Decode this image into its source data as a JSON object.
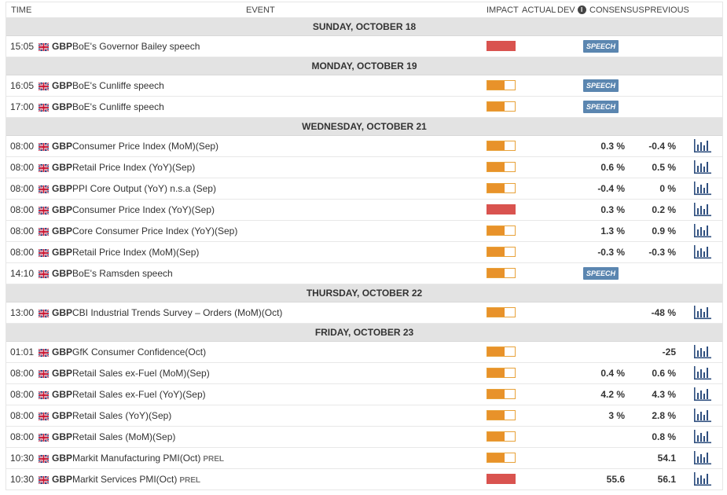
{
  "header": {
    "time": "TIME",
    "event": "EVENT",
    "impact": "IMPACT",
    "actual": "ACTUAL",
    "dev": "DEV",
    "consensus": "CONSENSUS",
    "previous": "PREVIOUS"
  },
  "colors": {
    "high_impact": "#d9534f",
    "medium_impact": "#e8922a",
    "speech_badge": "#5b86b0",
    "day_header_bg": "#e3e3e3",
    "chart_icon": "#2f4f7f"
  },
  "days": [
    {
      "label": "SUNDAY, OCTOBER 18",
      "events": [
        {
          "time": "15:05",
          "currency": "GBP",
          "name": "BoE's Governor Bailey speech",
          "tag": "",
          "impact": "high",
          "actual": "",
          "consensus": "",
          "previous": "",
          "speech": "SPEECH",
          "chart": false
        }
      ]
    },
    {
      "label": "MONDAY, OCTOBER 19",
      "events": [
        {
          "time": "16:05",
          "currency": "GBP",
          "name": "BoE's Cunliffe speech",
          "tag": "",
          "impact": "medium",
          "actual": "",
          "consensus": "",
          "previous": "",
          "speech": "SPEECH",
          "chart": false
        },
        {
          "time": "17:00",
          "currency": "GBP",
          "name": "BoE's Cunliffe speech",
          "tag": "",
          "impact": "medium",
          "actual": "",
          "consensus": "",
          "previous": "",
          "speech": "SPEECH",
          "chart": false
        }
      ]
    },
    {
      "label": "WEDNESDAY, OCTOBER 21",
      "events": [
        {
          "time": "08:00",
          "currency": "GBP",
          "name": "Consumer Price Index (MoM)(Sep)",
          "tag": "",
          "impact": "medium",
          "actual": "",
          "consensus": "0.3 %",
          "previous": "-0.4 %",
          "speech": "",
          "chart": true
        },
        {
          "time": "08:00",
          "currency": "GBP",
          "name": "Retail Price Index (YoY)(Sep)",
          "tag": "",
          "impact": "medium",
          "actual": "",
          "consensus": "0.6 %",
          "previous": "0.5 %",
          "speech": "",
          "chart": true
        },
        {
          "time": "08:00",
          "currency": "GBP",
          "name": "PPI Core Output (YoY) n.s.a (Sep)",
          "tag": "",
          "impact": "medium",
          "actual": "",
          "consensus": "-0.4 %",
          "previous": "0 %",
          "speech": "",
          "chart": true
        },
        {
          "time": "08:00",
          "currency": "GBP",
          "name": "Consumer Price Index (YoY)(Sep)",
          "tag": "",
          "impact": "high",
          "actual": "",
          "consensus": "0.3 %",
          "previous": "0.2 %",
          "speech": "",
          "chart": true
        },
        {
          "time": "08:00",
          "currency": "GBP",
          "name": "Core Consumer Price Index (YoY)(Sep)",
          "tag": "",
          "impact": "medium",
          "actual": "",
          "consensus": "1.3 %",
          "previous": "0.9 %",
          "speech": "",
          "chart": true
        },
        {
          "time": "08:00",
          "currency": "GBP",
          "name": "Retail Price Index (MoM)(Sep)",
          "tag": "",
          "impact": "medium",
          "actual": "",
          "consensus": "-0.3 %",
          "previous": "-0.3 %",
          "speech": "",
          "chart": true
        },
        {
          "time": "14:10",
          "currency": "GBP",
          "name": "BoE's Ramsden speech",
          "tag": "",
          "impact": "medium",
          "actual": "",
          "consensus": "",
          "previous": "",
          "speech": "SPEECH",
          "chart": false
        }
      ]
    },
    {
      "label": "THURSDAY, OCTOBER 22",
      "events": [
        {
          "time": "13:00",
          "currency": "GBP",
          "name": "CBI Industrial Trends Survey – Orders (MoM)(Oct)",
          "tag": "",
          "impact": "medium",
          "actual": "",
          "consensus": "",
          "previous": "-48 %",
          "speech": "",
          "chart": true
        }
      ]
    },
    {
      "label": "FRIDAY, OCTOBER 23",
      "events": [
        {
          "time": "01:01",
          "currency": "GBP",
          "name": "GfK Consumer Confidence(Oct)",
          "tag": "",
          "impact": "medium",
          "actual": "",
          "consensus": "",
          "previous": "-25",
          "speech": "",
          "chart": true
        },
        {
          "time": "08:00",
          "currency": "GBP",
          "name": "Retail Sales ex-Fuel (MoM)(Sep)",
          "tag": "",
          "impact": "medium",
          "actual": "",
          "consensus": "0.4 %",
          "previous": "0.6 %",
          "speech": "",
          "chart": true
        },
        {
          "time": "08:00",
          "currency": "GBP",
          "name": "Retail Sales ex-Fuel (YoY)(Sep)",
          "tag": "",
          "impact": "medium",
          "actual": "",
          "consensus": "4.2 %",
          "previous": "4.3 %",
          "speech": "",
          "chart": true
        },
        {
          "time": "08:00",
          "currency": "GBP",
          "name": "Retail Sales (YoY)(Sep)",
          "tag": "",
          "impact": "medium",
          "actual": "",
          "consensus": "3 %",
          "previous": "2.8 %",
          "speech": "",
          "chart": true
        },
        {
          "time": "08:00",
          "currency": "GBP",
          "name": "Retail Sales (MoM)(Sep)",
          "tag": "",
          "impact": "medium",
          "actual": "",
          "consensus": "",
          "previous": "0.8 %",
          "speech": "",
          "chart": true
        },
        {
          "time": "10:30",
          "currency": "GBP",
          "name": "Markit Manufacturing PMI(Oct)",
          "tag": "PREL",
          "impact": "medium",
          "actual": "",
          "consensus": "",
          "previous": "54.1",
          "speech": "",
          "chart": true
        },
        {
          "time": "10:30",
          "currency": "GBP",
          "name": "Markit Services PMI(Oct)",
          "tag": "PREL",
          "impact": "high",
          "actual": "",
          "consensus": "55.6",
          "previous": "56.1",
          "speech": "",
          "chart": true
        }
      ]
    }
  ]
}
